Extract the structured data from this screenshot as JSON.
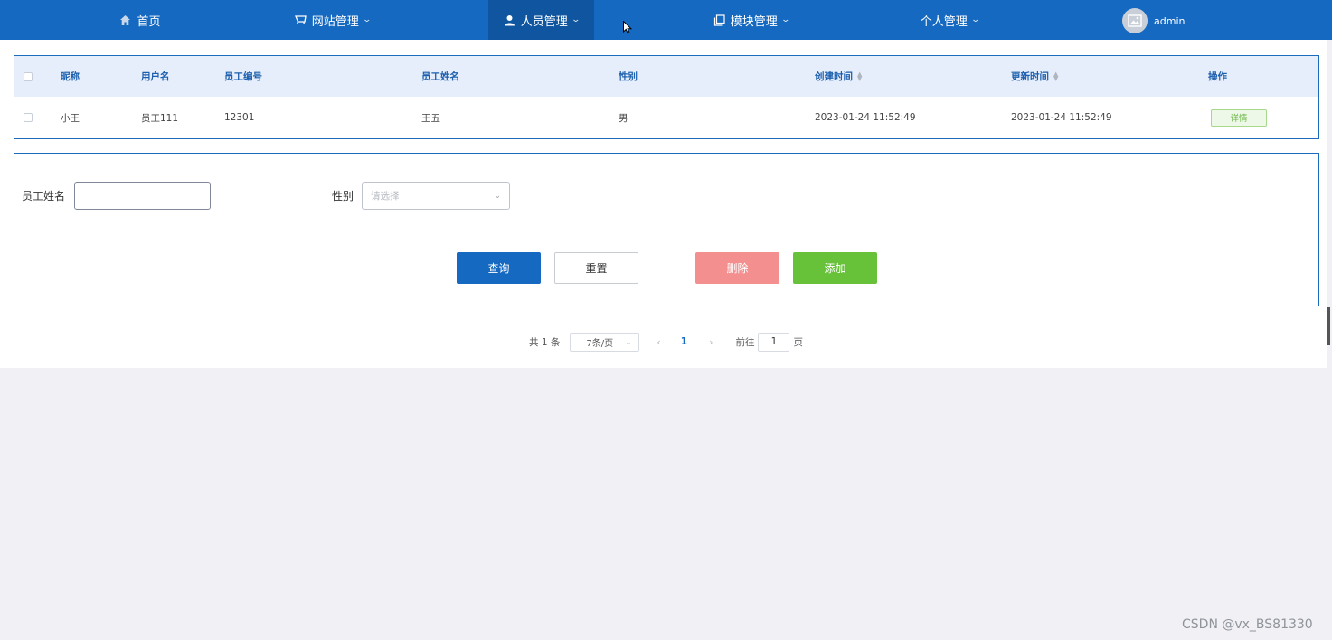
{
  "nav": {
    "items": [
      {
        "label": "首页",
        "icon": "home-icon"
      },
      {
        "label": "网站管理",
        "icon": "cart-icon"
      },
      {
        "label": "人员管理",
        "icon": "user-icon"
      },
      {
        "label": "模块管理",
        "icon": "copy-icon"
      },
      {
        "label": "个人管理",
        "icon": ""
      }
    ],
    "user_name": "admin",
    "accent": "#1669c0",
    "active_color": "#0f559f"
  },
  "table": {
    "headers": [
      "昵称",
      "用户名",
      "员工编号",
      "员工姓名",
      "性别",
      "创建时间",
      "更新时间",
      "操作"
    ],
    "rows": [
      {
        "nickname": "小王",
        "username": "员工111",
        "employee_no": "12301",
        "employee_name": "王五",
        "gender": "男",
        "created": "2023-01-24 11:52:49",
        "updated": "2023-01-24 11:52:49",
        "action": "详情"
      }
    ]
  },
  "form": {
    "name_label": "员工姓名",
    "name_value": "",
    "gender_label": "性别",
    "gender_placeholder": "请选择",
    "query_button": "查询",
    "reset_button": "重置",
    "delete_button": "删除",
    "add_button": "添加"
  },
  "pagination": {
    "total_text": "共 1 条",
    "page_size": "7条/页",
    "current_page": "1",
    "goto_label": "前往",
    "goto_value": "1",
    "page_unit": "页"
  },
  "watermark": "CSDN @vx_BS81330"
}
